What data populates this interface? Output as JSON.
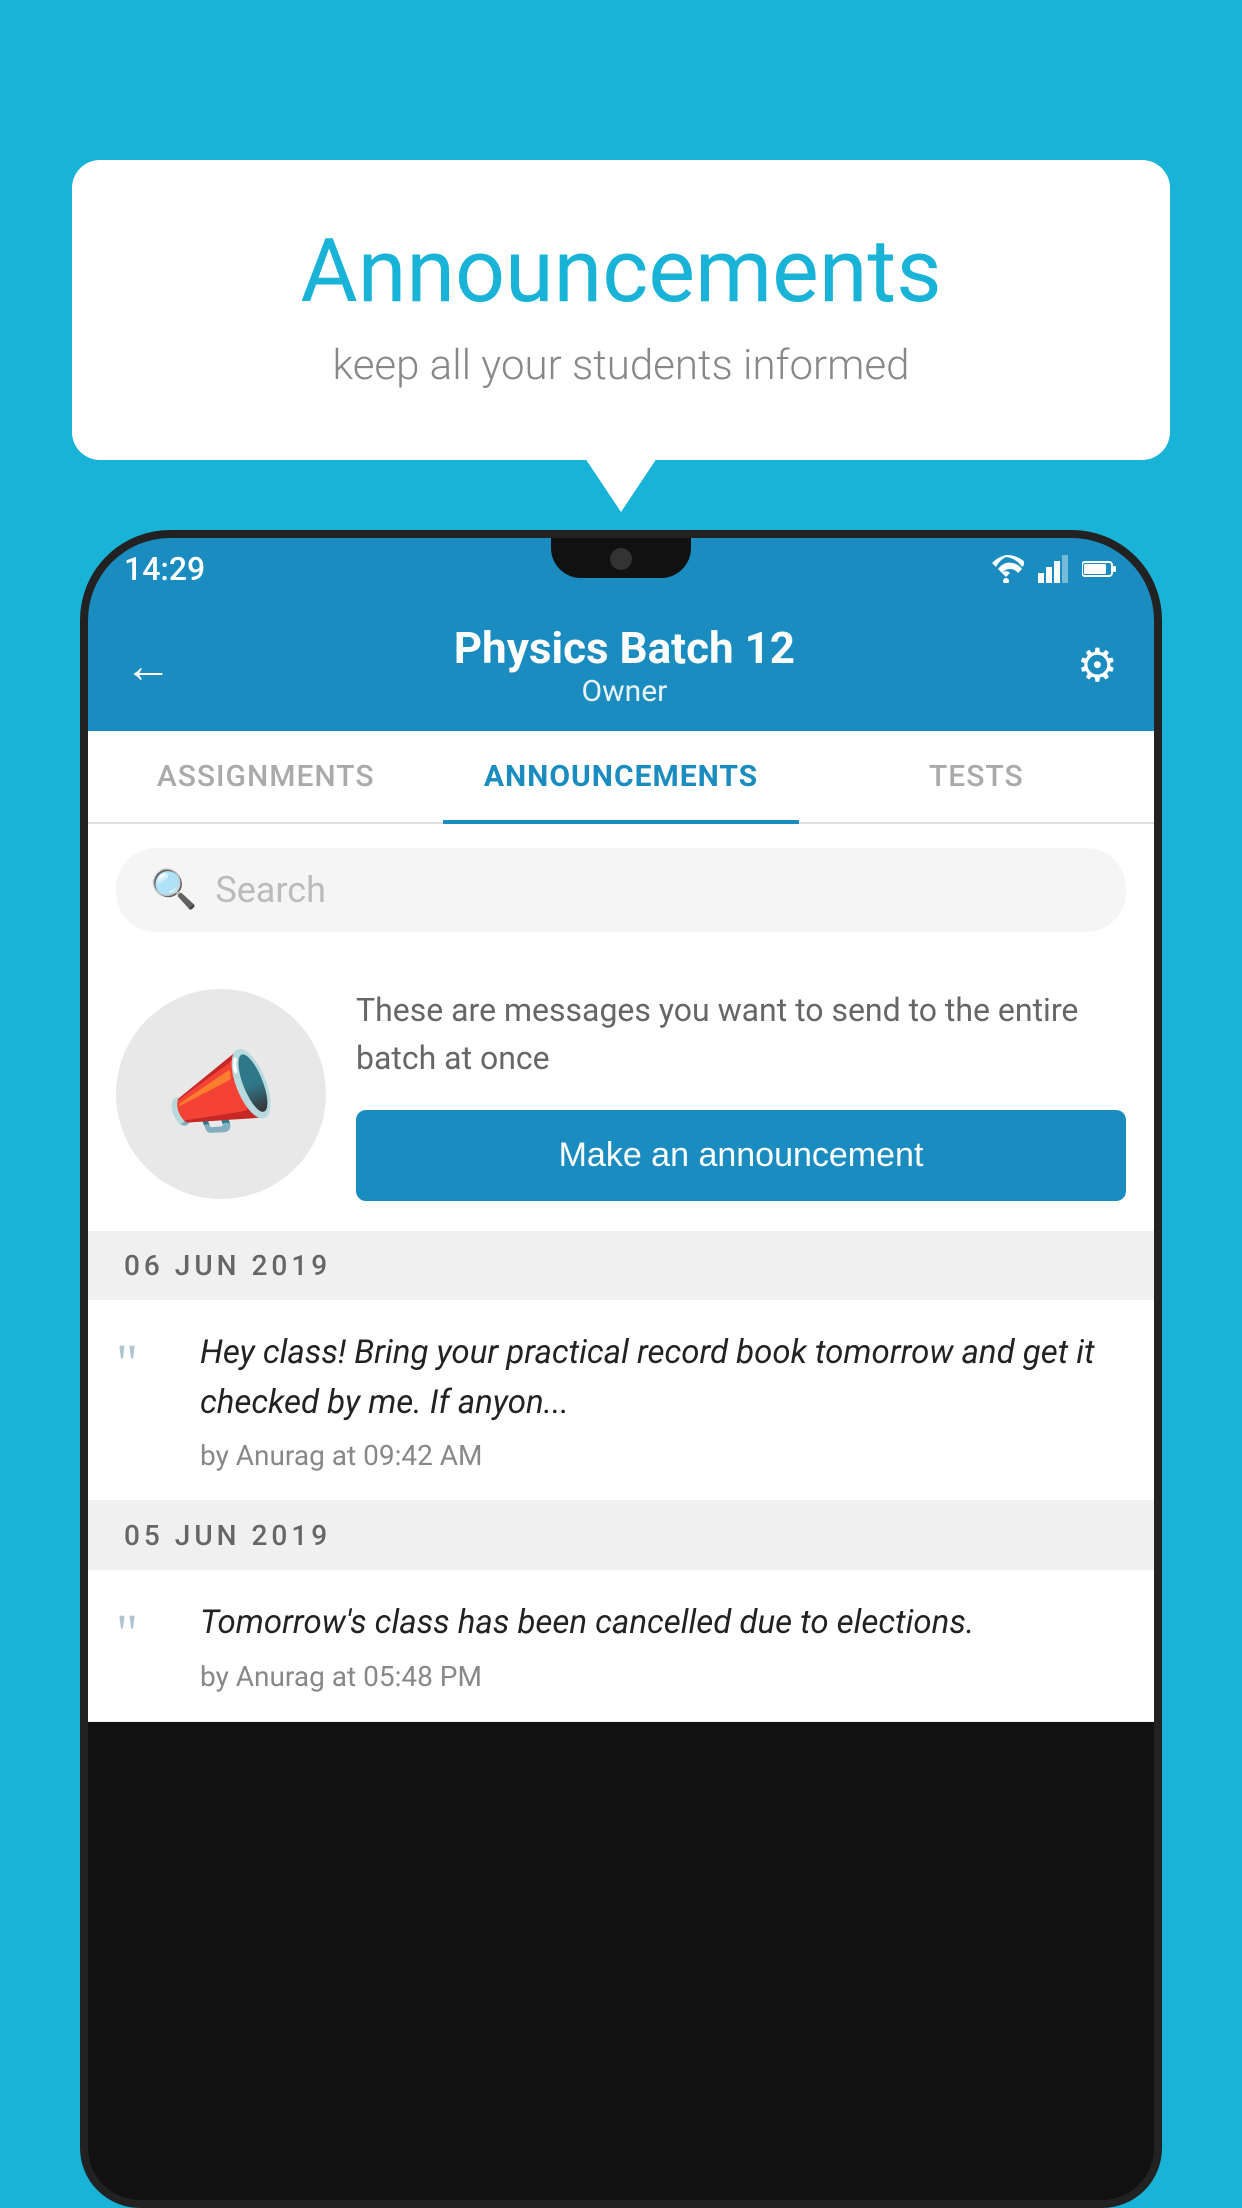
{
  "background_color": "#1ab3d8",
  "speech_bubble": {
    "title": "Announcements",
    "subtitle": "keep all your students informed"
  },
  "phone": {
    "status_bar": {
      "time": "14:29",
      "icons": [
        "wifi",
        "signal",
        "battery"
      ]
    },
    "header": {
      "title": "Physics Batch 12",
      "subtitle": "Owner",
      "back_icon": "←",
      "gear_icon": "⚙"
    },
    "tabs": [
      {
        "label": "ASSIGNMENTS",
        "active": false
      },
      {
        "label": "ANNOUNCEMENTS",
        "active": true
      },
      {
        "label": "TESTS",
        "active": false
      }
    ],
    "search": {
      "placeholder": "Search"
    },
    "promo": {
      "description": "These are messages you want to send to the entire batch at once",
      "button_label": "Make an announcement"
    },
    "announcements": [
      {
        "date": "06  JUN  2019",
        "text": "Hey class! Bring your practical record book tomorrow and get it checked by me. If anyon...",
        "meta": "by Anurag at 09:42 AM"
      },
      {
        "date": "05  JUN  2019",
        "text": "Tomorrow's class has been cancelled due to elections.",
        "meta": "by Anurag at 05:48 PM"
      }
    ]
  }
}
